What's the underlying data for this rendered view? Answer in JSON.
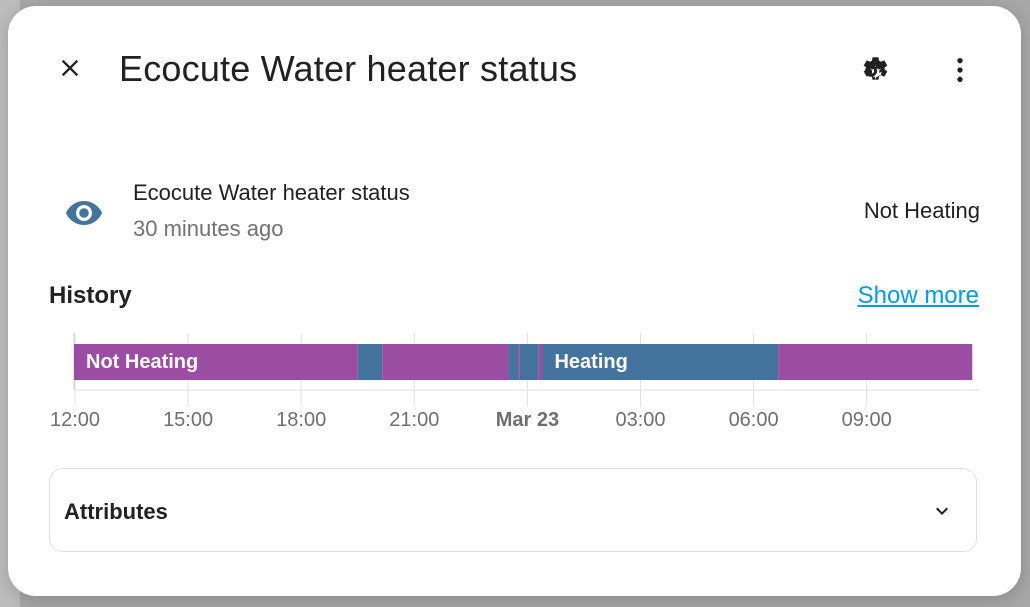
{
  "dialog": {
    "title": "Ecocute Water heater status",
    "close_icon": "close-icon",
    "settings_icon": "gear-icon",
    "more_icon": "more-vertical-icon"
  },
  "entity": {
    "icon": "eye-icon",
    "icon_color": "#44739e",
    "name": "Ecocute Water heater status",
    "last_changed": "30 minutes ago",
    "state": "Not Heating"
  },
  "history": {
    "title": "History",
    "show_more": "Show more",
    "link_color": "#039be5"
  },
  "chart_data": {
    "type": "timeline",
    "x_ticks": [
      "12:00",
      "15:00",
      "18:00",
      "21:00",
      "Mar 23",
      "03:00",
      "06:00",
      "09:00"
    ],
    "x_tick_bold": "Mar 23",
    "states": {
      "Not Heating": "#9b4da3",
      "Heating": "#44739e"
    },
    "segments": [
      {
        "state": "Heating",
        "start": 11.75,
        "end": 11.85
      },
      {
        "state": "Not Heating",
        "start": 11.85,
        "end": 19.5,
        "label": "Not Heating"
      },
      {
        "state": "Heating",
        "start": 19.5,
        "end": 20.15
      },
      {
        "state": "Not Heating",
        "start": 20.15,
        "end": 23.5
      },
      {
        "state": "Heating",
        "start": 23.5,
        "end": 23.75
      },
      {
        "state": "Not Heating",
        "start": 23.75,
        "end": 23.8
      },
      {
        "state": "Heating",
        "start": 23.8,
        "end": 24.3
      },
      {
        "state": "Not Heating",
        "start": 24.3,
        "end": 24.4
      },
      {
        "state": "Heating",
        "start": 24.4,
        "end": 30.65,
        "label": "Heating"
      },
      {
        "state": "Not Heating",
        "start": 30.65,
        "end": 35.8
      }
    ],
    "x_range_hours": [
      11.75,
      35.8
    ]
  },
  "attributes": {
    "label": "Attributes",
    "chevron_icon": "chevron-down-icon"
  }
}
